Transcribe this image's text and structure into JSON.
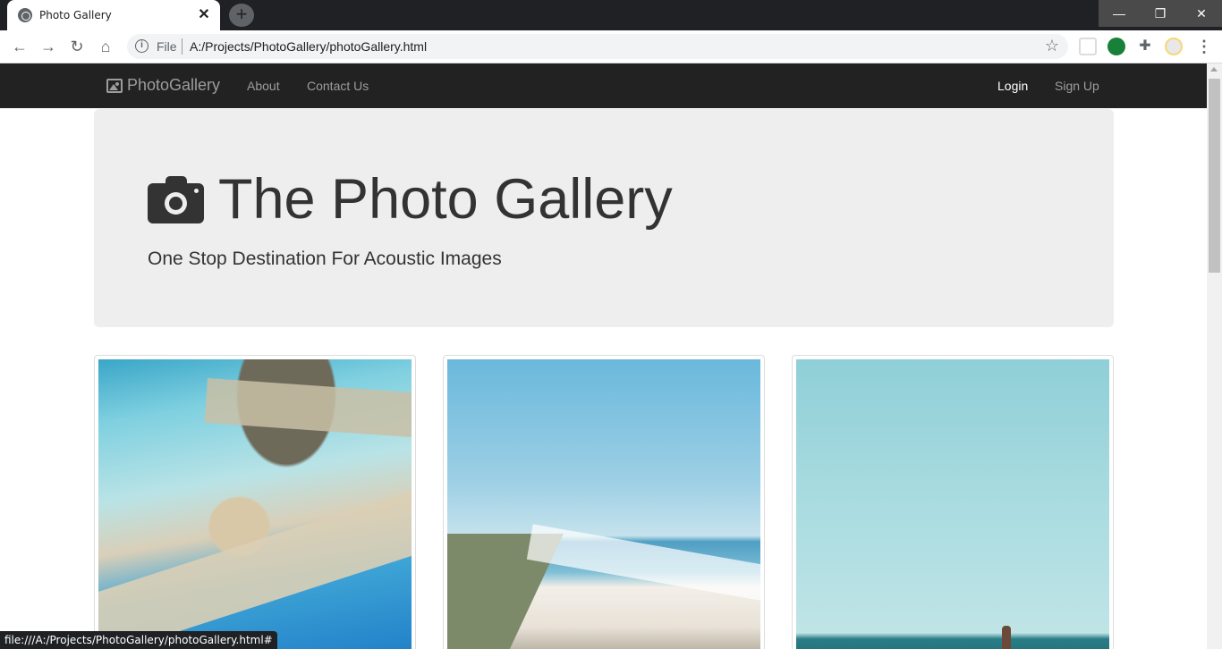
{
  "browser": {
    "tab_title": "Photo Gallery",
    "tab_close": "✕",
    "new_tab": "+",
    "window_controls": {
      "minimize": "—",
      "maximize": "❐",
      "close": "✕"
    },
    "omnibox": {
      "scheme": "File",
      "url": "A:/Projects/PhotoGallery/photoGallery.html"
    },
    "status_bar": "file:///A:/Projects/PhotoGallery/photoGallery.html#"
  },
  "navbar": {
    "brand": "PhotoGallery",
    "links": [
      "About",
      "Contact Us"
    ],
    "right_links": [
      "Login",
      "Sign Up"
    ]
  },
  "jumbotron": {
    "title": "The Photo Gallery",
    "tagline": "One Stop Destination For Acoustic Images"
  },
  "gallery": {
    "images": [
      {
        "name": "beach-lagoon-photo"
      },
      {
        "name": "coastline-photo"
      },
      {
        "name": "sky-sea-photo"
      }
    ]
  },
  "colors": {
    "navbar_bg": "#222222",
    "jumbotron_bg": "#eeeeee",
    "nav_text": "#9d9d9d",
    "active_text": "#ffffff"
  }
}
